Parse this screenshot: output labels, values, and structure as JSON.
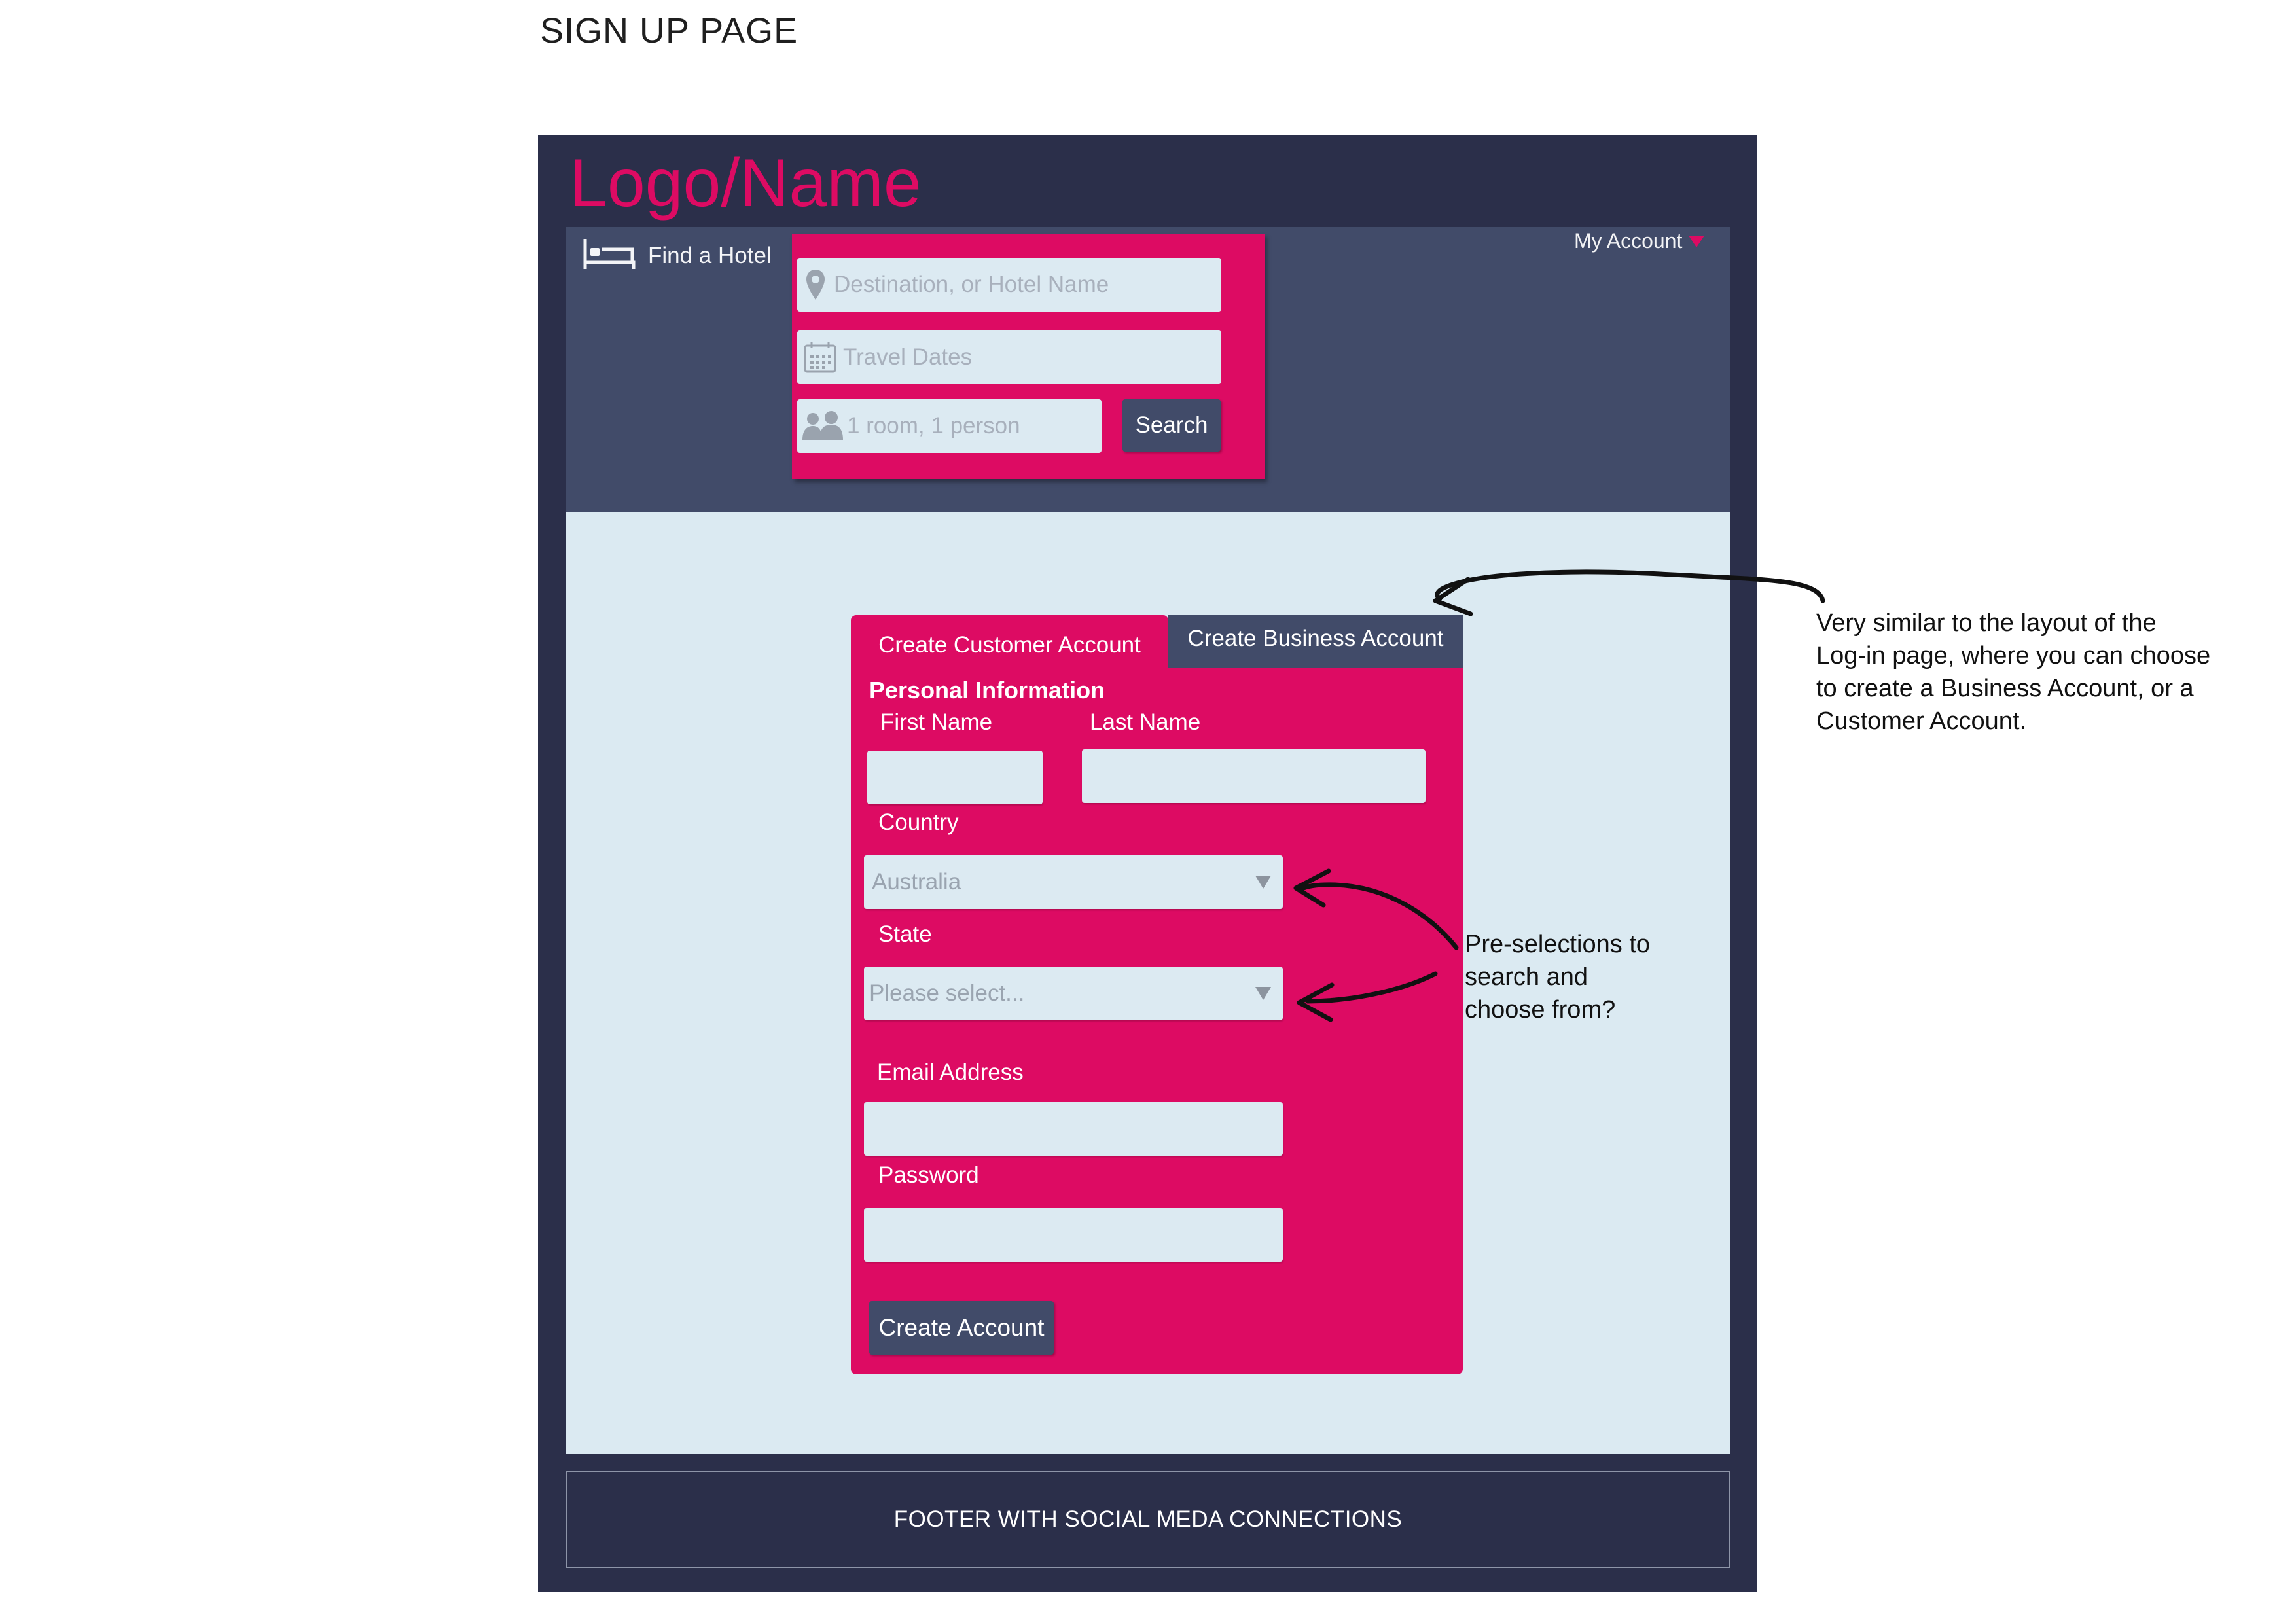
{
  "page_heading": "SIGN UP PAGE",
  "header": {
    "logo": "Logo/Name",
    "find_hotel_label": "Find a Hotel",
    "my_account_label": "My Account"
  },
  "search": {
    "destination_placeholder": "Destination, or Hotel Name",
    "dates_placeholder": "Travel Dates",
    "guests_placeholder": "1 room, 1 person",
    "search_label": "Search"
  },
  "tabs": [
    {
      "label": "Create Customer Account",
      "active": true
    },
    {
      "label": "Create Business Account",
      "active": false
    }
  ],
  "form": {
    "section_title": "Personal Information",
    "first_name_label": "First Name",
    "last_name_label": "Last Name",
    "country_label": "Country",
    "country_value": "Australia",
    "state_label": "State",
    "state_placeholder": "Please select...",
    "email_label": "Email Address",
    "password_label": "Password",
    "submit_label": "Create Account"
  },
  "footer": {
    "text": "FOOTER WITH SOCIAL MEDA CONNECTIONS"
  },
  "annotations": {
    "tabs_note": [
      "Very similar to the layout of the",
      "Log-in page, where you can choose",
      "to create a Business Account, or a",
      "Customer Account."
    ],
    "selects_note": [
      "Pre-selections to",
      "search and",
      "choose from?"
    ]
  },
  "colors": {
    "frame": "#2b2f4a",
    "hero": "#414b69",
    "accent": "#dd0b63",
    "content_bg": "#dbeaf2",
    "field_bg": "#dceaf2"
  },
  "icons": {
    "find_hotel": "bed-icon",
    "my_account": "caret-down-icon",
    "destination": "location-pin-icon",
    "dates": "calendar-icon",
    "guests": "people-icon",
    "select_arrow": "triangle-down-icon"
  }
}
